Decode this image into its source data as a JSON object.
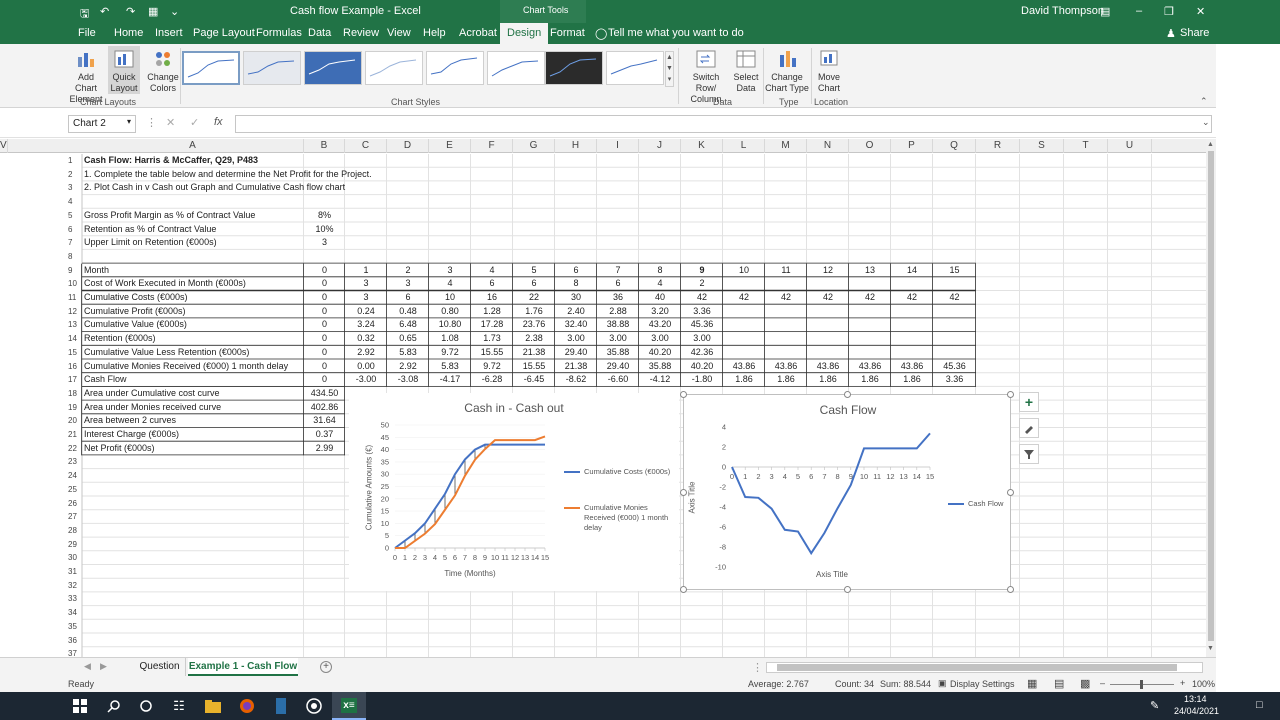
{
  "titlebar": {
    "doc_title": "Cash flow Example - Excel",
    "context_group": "Chart Tools",
    "user": "David Thompson"
  },
  "ribbon_tabs": [
    "File",
    "Home",
    "Insert",
    "Page Layout",
    "Formulas",
    "Data",
    "Review",
    "View",
    "Help",
    "Acrobat",
    "Design",
    "Format"
  ],
  "tell_me": "Tell me what you want to do",
  "share": "Share",
  "ribbon": {
    "add_chart_element": [
      "Add Chart",
      "Element"
    ],
    "quick_layout": [
      "Quick",
      "Layout"
    ],
    "change_colors": [
      "Change",
      "Colors"
    ],
    "chart_layouts_label": "Chart Layouts",
    "chart_styles_label": "Chart Styles",
    "switch_row_col": [
      "Switch Row/",
      "Column"
    ],
    "select_data": [
      "Select",
      "Data"
    ],
    "data_label": "Data",
    "change_chart_type": [
      "Change",
      "Chart Type"
    ],
    "type_label": "Type",
    "move_chart": [
      "Move",
      "Chart"
    ],
    "location_label": "Location"
  },
  "formula": {
    "name_box": "Chart 2",
    "fx": "fx",
    "value": ""
  },
  "columns": [
    "A",
    "B",
    "C",
    "D",
    "E",
    "F",
    "G",
    "H",
    "I",
    "J",
    "K",
    "L",
    "M",
    "N",
    "O",
    "P",
    "Q",
    "R",
    "S",
    "T",
    "U",
    "V"
  ],
  "rows": [
    "1",
    "2",
    "3",
    "4",
    "5",
    "6",
    "7",
    "8",
    "9",
    "10",
    "11",
    "12",
    "13",
    "14",
    "15",
    "16",
    "17",
    "18",
    "19",
    "20",
    "21",
    "22",
    "23",
    "24",
    "25",
    "26",
    "27",
    "28",
    "29",
    "30",
    "31",
    "32",
    "33",
    "34",
    "35",
    "36",
    "37"
  ],
  "sheet": {
    "text_rows": [
      {
        "r": 1,
        "a": "Cash Flow: Harris & McCaffer, Q29, P483",
        "bold": true
      },
      {
        "r": 2,
        "a": "1. Complete the table below and determine the Net Profit for the Project."
      },
      {
        "r": 3,
        "a": "2. Plot Cash in v Cash out Graph and Cumulative Cash flow chart"
      },
      {
        "r": 5,
        "a": "Gross Profit Margin as % of Contract Value",
        "b": "8%"
      },
      {
        "r": 6,
        "a": "Retention as % of Contract Value",
        "b": "10%"
      },
      {
        "r": 7,
        "a": "Upper Limit on Retention (€000s)",
        "b": "3"
      }
    ],
    "table": [
      {
        "r": 9,
        "a": "Month",
        "vals": [
          "0",
          "1",
          "2",
          "3",
          "4",
          "5",
          "6",
          "7",
          "8",
          "9",
          "10",
          "11",
          "12",
          "13",
          "14",
          "15"
        ]
      },
      {
        "r": 10,
        "a": "Cost of Work Executed in Month (€000s)",
        "vals": [
          "0",
          "3",
          "3",
          "4",
          "6",
          "6",
          "8",
          "6",
          "4",
          "2",
          "",
          "",
          "",
          "",
          "",
          ""
        ]
      },
      {
        "r": 11,
        "a": "Cumulative Costs  (€000s)",
        "vals": [
          "0",
          "3",
          "6",
          "10",
          "16",
          "22",
          "30",
          "36",
          "40",
          "42",
          "42",
          "42",
          "42",
          "42",
          "42",
          "42"
        ]
      },
      {
        "r": 12,
        "a": "Cumulative Profit (€000s)",
        "vals": [
          "0",
          "0.24",
          "0.48",
          "0.80",
          "1.28",
          "1.76",
          "2.40",
          "2.88",
          "3.20",
          "3.36",
          "",
          "",
          "",
          "",
          "",
          ""
        ]
      },
      {
        "r": 13,
        "a": "Cumulative Value (€000s)",
        "vals": [
          "0",
          "3.24",
          "6.48",
          "10.80",
          "17.28",
          "23.76",
          "32.40",
          "38.88",
          "43.20",
          "45.36",
          "",
          "",
          "",
          "",
          "",
          ""
        ]
      },
      {
        "r": 14,
        "a": "Retention (€000s)",
        "vals": [
          "0",
          "0.32",
          "0.65",
          "1.08",
          "1.73",
          "2.38",
          "3.00",
          "3.00",
          "3.00",
          "3.00",
          "",
          "",
          "",
          "",
          "",
          ""
        ]
      },
      {
        "r": 15,
        "a": "Cumulative Value Less Retention (€000s)",
        "vals": [
          "0",
          "2.92",
          "5.83",
          "9.72",
          "15.55",
          "21.38",
          "29.40",
          "35.88",
          "40.20",
          "42.36",
          "",
          "",
          "",
          "",
          "",
          ""
        ]
      },
      {
        "r": 16,
        "a": "Cumulative Monies Received (€000) 1 month delay",
        "vals": [
          "0",
          "0.00",
          "2.92",
          "5.83",
          "9.72",
          "15.55",
          "21.38",
          "29.40",
          "35.88",
          "40.20",
          "43.86",
          "43.86",
          "43.86",
          "43.86",
          "43.86",
          "45.36"
        ]
      },
      {
        "r": 17,
        "a": "Cash Flow",
        "vals": [
          "0",
          "-3.00",
          "-3.08",
          "-4.17",
          "-6.28",
          "-6.45",
          "-8.62",
          "-6.60",
          "-4.12",
          "-1.80",
          "1.86",
          "1.86",
          "1.86",
          "1.86",
          "1.86",
          "3.36"
        ]
      }
    ],
    "summary": [
      {
        "r": 18,
        "a": "Area under Cumulative cost curve",
        "b": "434.50"
      },
      {
        "r": 19,
        "a": "Area under Monies received curve",
        "b": "402.86"
      },
      {
        "r": 20,
        "a": "Area between 2 curves",
        "b": "31.64"
      },
      {
        "r": 21,
        "a": "Interest Charge (€000s)",
        "b": "0.37"
      },
      {
        "r": 22,
        "a": "Net Profit (€000s)",
        "b": "2.99"
      }
    ]
  },
  "chart_data": [
    {
      "type": "line",
      "title": "Cash in - Cash out",
      "xlabel": "Time (Months)",
      "ylabel": "Cumulative Amounts (€)",
      "categories": [
        "0",
        "1",
        "2",
        "3",
        "4",
        "5",
        "6",
        "7",
        "8",
        "9",
        "10",
        "11",
        "12",
        "13",
        "14",
        "15"
      ],
      "yticks": [
        "0",
        "5",
        "10",
        "15",
        "20",
        "25",
        "30",
        "35",
        "40",
        "45",
        "50"
      ],
      "ylim": [
        0,
        50
      ],
      "legend": "right",
      "series": [
        {
          "name": "Cumulative Costs  (€000s)",
          "color": "#4472c4",
          "values": [
            0,
            3,
            6,
            10,
            16,
            22,
            30,
            36,
            40,
            42,
            42,
            42,
            42,
            42,
            42,
            42
          ]
        },
        {
          "name": "Cumulative Monies Received (€000) 1 month delay",
          "color": "#ed7d31",
          "values": [
            0,
            0,
            2.92,
            5.83,
            9.72,
            15.55,
            21.38,
            29.4,
            35.88,
            40.2,
            43.86,
            43.86,
            43.86,
            43.86,
            43.86,
            45.36
          ]
        }
      ]
    },
    {
      "type": "line",
      "title": "Cash Flow",
      "xlabel": "Axis Title",
      "ylabel": "Axis Title",
      "categories": [
        "0",
        "1",
        "2",
        "3",
        "4",
        "5",
        "6",
        "7",
        "8",
        "9",
        "10",
        "11",
        "12",
        "13",
        "14",
        "15"
      ],
      "yticks": [
        "-10",
        "-8",
        "-6",
        "-4",
        "-2",
        "0",
        "2",
        "4"
      ],
      "ylim": [
        -10,
        4
      ],
      "legend": "right",
      "series": [
        {
          "name": "Cash Flow",
          "color": "#4472c4",
          "values": [
            0,
            -3,
            -3.08,
            -4.17,
            -6.28,
            -6.45,
            -8.62,
            -6.6,
            -4.12,
            -1.8,
            1.86,
            1.86,
            1.86,
            1.86,
            1.86,
            3.36
          ]
        }
      ]
    }
  ],
  "sheet_tabs": [
    "Question",
    "Example 1 - Cash Flow"
  ],
  "status": {
    "ready": "Ready",
    "average": "Average: 2.767",
    "count": "Count: 34",
    "sum": "Sum: 88.544",
    "display_settings": "Display Settings",
    "zoom": "100%"
  },
  "taskbar": {
    "time": "13:14",
    "date": "24/04/2021"
  }
}
